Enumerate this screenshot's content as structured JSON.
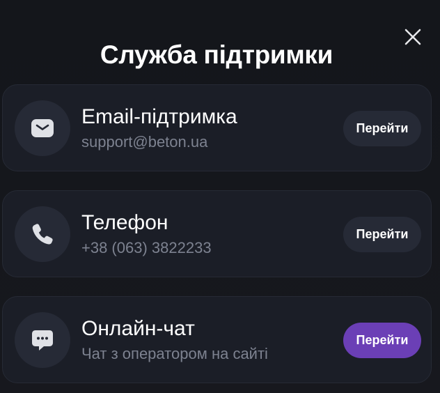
{
  "modal": {
    "title": "Служба підтримки",
    "close_icon": "close-icon"
  },
  "colors": {
    "background": "#15171c",
    "card": "#1b1e27",
    "icon_circle": "#262a36",
    "button": "#262a36",
    "primary_button": "#6b3fb6",
    "secondary_text": "#7d8290"
  },
  "cards": [
    {
      "icon": "mail-icon",
      "title": "Email-підтримка",
      "subtitle": "support@beton.ua",
      "button_label": "Перейти"
    },
    {
      "icon": "phone-icon",
      "title": "Телефон",
      "subtitle": "+38 (063) 3822233",
      "button_label": "Перейти"
    },
    {
      "icon": "chat-icon",
      "title": "Онлайн-чат",
      "subtitle": "Чат з оператором на сайті",
      "button_label": "Перейти",
      "highlighted": true
    }
  ]
}
